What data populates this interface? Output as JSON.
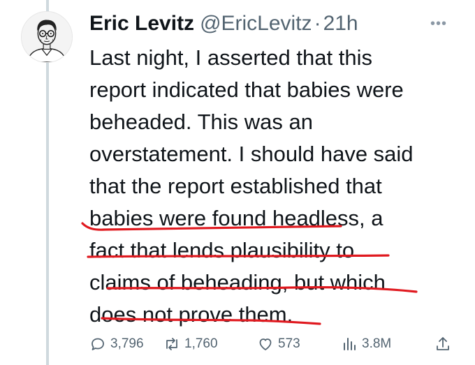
{
  "tweet": {
    "author_name": "Eric Levitz",
    "author_handle": "@EricLevitz",
    "separator": "·",
    "timestamp": "21h",
    "text_lines": [
      "Last night, I asserted that this",
      "report indicated that babies were",
      "beheaded. This was an",
      "overstatement. I should have said",
      "that the report established that",
      "babies were found headless, a",
      "fact that lends plausibility to",
      "claims of beheading, but which",
      "does not prove them."
    ]
  },
  "actions": {
    "replies": "3,796",
    "retweets": "1,760",
    "likes": "573",
    "views": "3.8M"
  },
  "icons": {
    "reply": "reply-icon",
    "retweet": "retweet-icon",
    "like": "heart-icon",
    "views": "views-icon",
    "share": "share-icon",
    "more": "more-icon"
  },
  "colors": {
    "text": "#0f1419",
    "secondary": "#536471",
    "underline": "#e0191f"
  }
}
